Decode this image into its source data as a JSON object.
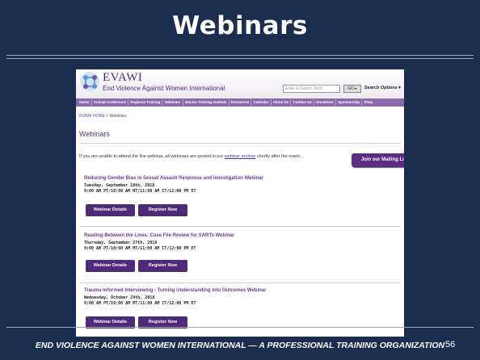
{
  "slide": {
    "title": "Webinars",
    "footer": "END VIOLENCE AGAINST WOMEN INTERNATIONAL — A PROFESSIONAL TRAINING ORGANIZATION",
    "page_number": "56"
  },
  "site": {
    "brand": "EVAWI",
    "brand_sub": "End Violence Against Women International",
    "search_placeholder": "Enter A Search Term",
    "go_label": "GO ▸",
    "search_options_label": "Search Options ▾",
    "nav": [
      "Home",
      "Annual Conference",
      "Regional Training",
      "Webinars",
      "OnLine Training Institute",
      "Resources",
      "Calendar",
      "About Us",
      "Contact Us",
      "Donations",
      "Sponsorship",
      "Shop"
    ],
    "breadcrumb_home": "EVAWI HOME",
    "breadcrumb_sep": " > ",
    "breadcrumb_current": "Webinars",
    "page_heading": "Webinars",
    "intro_before": "If you are unable to attend the live webinar, all webinars are posted in our ",
    "intro_link": "webinar archive",
    "intro_after": " shortly after the event.",
    "mailing_list_label": "Join our Mailing List",
    "details_label": "Webinar Details",
    "register_label": "Register Now",
    "events": [
      {
        "title": "Reducing Gender Bias in Sexual Assault Response and Investigation Webinar",
        "date": "Tuesday, September 18th, 2018",
        "time": "9:00 AM PT/10:00 AM MT/11:00 AM CT/12:00 PM ET"
      },
      {
        "title": "Reading Between the Lines: Case File Review for SARTs Webinar",
        "date": "Thursday, September 27th, 2018",
        "time": "9:00 AM PT/10:00 AM MT/11:00 AM CT/12:00 PM ET"
      },
      {
        "title": "Trauma Informed Interviewing - Turning Understanding into Outcomes Webinar",
        "date": "Wednesday, October 24th, 2018",
        "time": "9:00 AM PT/10:00 AM MT/11:00 AM CT/12:00 PM ET"
      }
    ]
  }
}
